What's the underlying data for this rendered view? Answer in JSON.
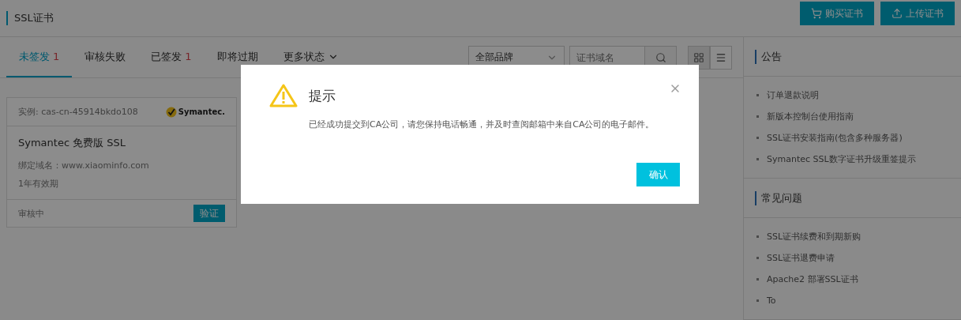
{
  "header": {
    "title": "SSL证书",
    "buttons": [
      {
        "kind": "cart",
        "label": "购买证书"
      },
      {
        "kind": "upload",
        "label": "上传证书"
      }
    ]
  },
  "tabs": [
    {
      "label": "未签发",
      "count": "1",
      "selected": true
    },
    {
      "label": "审核失败",
      "selected": false
    },
    {
      "label": "已签发",
      "count": "1",
      "selected": false
    },
    {
      "label": "即将过期",
      "selected": false
    },
    {
      "label": "更多状态",
      "selected": false,
      "dropdown": true
    }
  ],
  "filters": {
    "brand": "全部品牌",
    "search": {
      "placeholder": "证书域名"
    },
    "views": [
      {
        "kind": "grid",
        "selected": true
      },
      {
        "kind": "list",
        "selected": false
      }
    ]
  },
  "card": {
    "instance": "实例: cas-cn-45914bkdo108",
    "logo": "Symantec.",
    "title": "Symantec 免费版 SSL",
    "domain": "绑定域名：www.xiaominfo.com",
    "validity": "1年有效期",
    "status": "审核中",
    "action": "验证"
  },
  "sidebar": [
    {
      "title": "公告",
      "items": [
        "订单退款说明",
        "新版本控制台使用指南",
        "SSL证书安装指南(包含多种服务器)",
        "Symantec SSL数字证书升级重签提示"
      ]
    },
    {
      "title": "常见问题",
      "items": [
        "SSL证书续费和到期新购",
        "SSL证书退费申请",
        "Apache2 部署SSL证书",
        "To"
      ]
    }
  ],
  "dialog": {
    "title": "提示",
    "message": "已经成功提交到CA公司，请您保持电话畅通，并及时查阅邮箱中来自CA公司的电子邮件。",
    "confirm": "确认"
  }
}
